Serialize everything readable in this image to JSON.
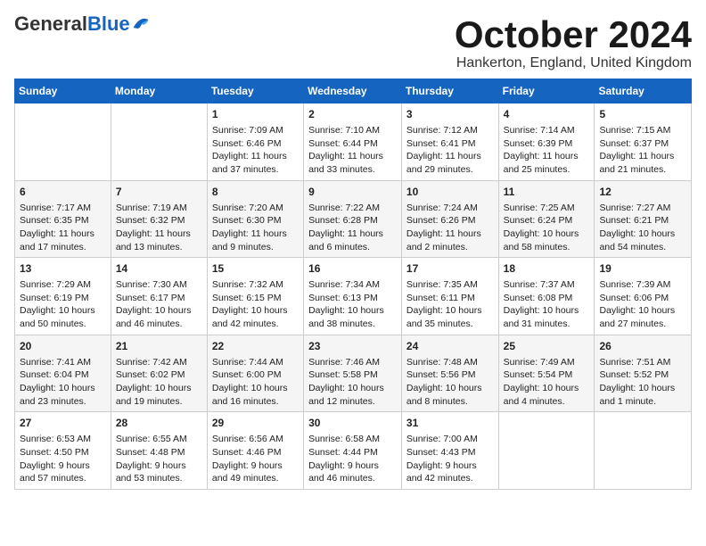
{
  "header": {
    "logo_general": "General",
    "logo_blue": "Blue",
    "month_title": "October 2024",
    "location": "Hankerton, England, United Kingdom"
  },
  "days_of_week": [
    "Sunday",
    "Monday",
    "Tuesday",
    "Wednesday",
    "Thursday",
    "Friday",
    "Saturday"
  ],
  "weeks": [
    [
      {
        "day": "",
        "content": ""
      },
      {
        "day": "",
        "content": ""
      },
      {
        "day": "1",
        "content": "Sunrise: 7:09 AM\nSunset: 6:46 PM\nDaylight: 11 hours and 37 minutes."
      },
      {
        "day": "2",
        "content": "Sunrise: 7:10 AM\nSunset: 6:44 PM\nDaylight: 11 hours and 33 minutes."
      },
      {
        "day": "3",
        "content": "Sunrise: 7:12 AM\nSunset: 6:41 PM\nDaylight: 11 hours and 29 minutes."
      },
      {
        "day": "4",
        "content": "Sunrise: 7:14 AM\nSunset: 6:39 PM\nDaylight: 11 hours and 25 minutes."
      },
      {
        "day": "5",
        "content": "Sunrise: 7:15 AM\nSunset: 6:37 PM\nDaylight: 11 hours and 21 minutes."
      }
    ],
    [
      {
        "day": "6",
        "content": "Sunrise: 7:17 AM\nSunset: 6:35 PM\nDaylight: 11 hours and 17 minutes."
      },
      {
        "day": "7",
        "content": "Sunrise: 7:19 AM\nSunset: 6:32 PM\nDaylight: 11 hours and 13 minutes."
      },
      {
        "day": "8",
        "content": "Sunrise: 7:20 AM\nSunset: 6:30 PM\nDaylight: 11 hours and 9 minutes."
      },
      {
        "day": "9",
        "content": "Sunrise: 7:22 AM\nSunset: 6:28 PM\nDaylight: 11 hours and 6 minutes."
      },
      {
        "day": "10",
        "content": "Sunrise: 7:24 AM\nSunset: 6:26 PM\nDaylight: 11 hours and 2 minutes."
      },
      {
        "day": "11",
        "content": "Sunrise: 7:25 AM\nSunset: 6:24 PM\nDaylight: 10 hours and 58 minutes."
      },
      {
        "day": "12",
        "content": "Sunrise: 7:27 AM\nSunset: 6:21 PM\nDaylight: 10 hours and 54 minutes."
      }
    ],
    [
      {
        "day": "13",
        "content": "Sunrise: 7:29 AM\nSunset: 6:19 PM\nDaylight: 10 hours and 50 minutes."
      },
      {
        "day": "14",
        "content": "Sunrise: 7:30 AM\nSunset: 6:17 PM\nDaylight: 10 hours and 46 minutes."
      },
      {
        "day": "15",
        "content": "Sunrise: 7:32 AM\nSunset: 6:15 PM\nDaylight: 10 hours and 42 minutes."
      },
      {
        "day": "16",
        "content": "Sunrise: 7:34 AM\nSunset: 6:13 PM\nDaylight: 10 hours and 38 minutes."
      },
      {
        "day": "17",
        "content": "Sunrise: 7:35 AM\nSunset: 6:11 PM\nDaylight: 10 hours and 35 minutes."
      },
      {
        "day": "18",
        "content": "Sunrise: 7:37 AM\nSunset: 6:08 PM\nDaylight: 10 hours and 31 minutes."
      },
      {
        "day": "19",
        "content": "Sunrise: 7:39 AM\nSunset: 6:06 PM\nDaylight: 10 hours and 27 minutes."
      }
    ],
    [
      {
        "day": "20",
        "content": "Sunrise: 7:41 AM\nSunset: 6:04 PM\nDaylight: 10 hours and 23 minutes."
      },
      {
        "day": "21",
        "content": "Sunrise: 7:42 AM\nSunset: 6:02 PM\nDaylight: 10 hours and 19 minutes."
      },
      {
        "day": "22",
        "content": "Sunrise: 7:44 AM\nSunset: 6:00 PM\nDaylight: 10 hours and 16 minutes."
      },
      {
        "day": "23",
        "content": "Sunrise: 7:46 AM\nSunset: 5:58 PM\nDaylight: 10 hours and 12 minutes."
      },
      {
        "day": "24",
        "content": "Sunrise: 7:48 AM\nSunset: 5:56 PM\nDaylight: 10 hours and 8 minutes."
      },
      {
        "day": "25",
        "content": "Sunrise: 7:49 AM\nSunset: 5:54 PM\nDaylight: 10 hours and 4 minutes."
      },
      {
        "day": "26",
        "content": "Sunrise: 7:51 AM\nSunset: 5:52 PM\nDaylight: 10 hours and 1 minute."
      }
    ],
    [
      {
        "day": "27",
        "content": "Sunrise: 6:53 AM\nSunset: 4:50 PM\nDaylight: 9 hours and 57 minutes."
      },
      {
        "day": "28",
        "content": "Sunrise: 6:55 AM\nSunset: 4:48 PM\nDaylight: 9 hours and 53 minutes."
      },
      {
        "day": "29",
        "content": "Sunrise: 6:56 AM\nSunset: 4:46 PM\nDaylight: 9 hours and 49 minutes."
      },
      {
        "day": "30",
        "content": "Sunrise: 6:58 AM\nSunset: 4:44 PM\nDaylight: 9 hours and 46 minutes."
      },
      {
        "day": "31",
        "content": "Sunrise: 7:00 AM\nSunset: 4:43 PM\nDaylight: 9 hours and 42 minutes."
      },
      {
        "day": "",
        "content": ""
      },
      {
        "day": "",
        "content": ""
      }
    ]
  ]
}
